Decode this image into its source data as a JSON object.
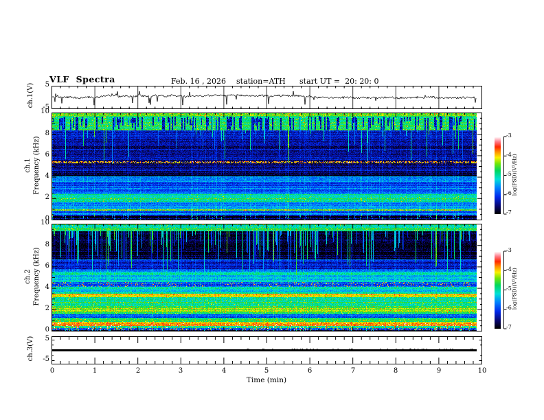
{
  "header": {
    "title": "VLF  Spectra",
    "date": "Feb. 16 , 2026",
    "station": "station=ATH",
    "start_ut": "start UT =  20: 20: 0"
  },
  "x_axis": {
    "label": "Time (min)",
    "min": 0,
    "max": 10,
    "tick_labels": [
      "0",
      "1",
      "2",
      "3",
      "4",
      "5",
      "6",
      "7",
      "8",
      "9",
      "10"
    ]
  },
  "panels": {
    "wave1": {
      "ylabel": "ch.1(V)",
      "ymax_label": "5",
      "ymin_label": "-5",
      "ylim": [
        -5,
        5
      ]
    },
    "spec1": {
      "channel_label": "ch.1",
      "ylabel": "Frequency (kHz)",
      "tick_labels": [
        "10",
        "8",
        "6",
        "4",
        "2",
        "0"
      ],
      "ylim": [
        0,
        10
      ]
    },
    "spec2": {
      "channel_label": "ch.2",
      "ylabel": "Frequency (kHz)",
      "tick_labels": [
        "10",
        "8",
        "6",
        "4",
        "2",
        "0"
      ],
      "ylim": [
        0,
        10
      ]
    },
    "wave3": {
      "ylabel": "ch.3(V)",
      "ymax_label": "5",
      "ymin_label": "-5",
      "ylim": [
        -5,
        5
      ]
    }
  },
  "colorbar": {
    "label": "log(PSD)(V²/Hz)",
    "tick_labels": [
      "-3",
      "-4",
      "-5",
      "-6",
      "-7"
    ],
    "zlim": [
      -7,
      -3
    ]
  },
  "colormap": {
    "stops": [
      [
        0.0,
        0,
        0,
        0
      ],
      [
        0.1,
        8,
        6,
        110
      ],
      [
        0.22,
        0,
        40,
        235
      ],
      [
        0.34,
        0,
        130,
        255
      ],
      [
        0.45,
        0,
        225,
        215
      ],
      [
        0.56,
        0,
        215,
        95
      ],
      [
        0.65,
        110,
        230,
        10
      ],
      [
        0.73,
        250,
        240,
        0
      ],
      [
        0.8,
        255,
        150,
        0
      ],
      [
        0.87,
        255,
        40,
        0
      ],
      [
        0.935,
        255,
        120,
        135
      ],
      [
        1.0,
        255,
        255,
        255
      ]
    ]
  },
  "chart_data": [
    {
      "type": "line",
      "name": "ch.1 voltage waveform",
      "ylabel": "ch.1(V)",
      "ylim": [
        -5,
        5
      ],
      "xlabel": "Time (min)",
      "xlim": [
        0,
        10
      ],
      "data_end_min": 9.88,
      "description": "Band-limited noise centered near +0.3 V (about ±0.8 V) with frequent impulsive downward spikes to -2…-4.5 V and sparser upward spikes to +1…+3 V",
      "mean_v": 0.3,
      "noise_v": 0.8,
      "seed": 42
    },
    {
      "type": "heatmap",
      "name": "ch.1 spectrogram",
      "channel": "ch.1",
      "xlabel": "Time (min)",
      "xlim": [
        0,
        10
      ],
      "ylabel": "Frequency (kHz)",
      "ylim": [
        0,
        10
      ],
      "zlabel": "log(PSD)(V²/Hz)",
      "zlim": [
        -7,
        -3
      ],
      "data_end_min": 9.88,
      "bands": [
        [
          9.8,
          10.01,
          -4.45
        ],
        [
          8.4,
          9.8,
          -4.75
        ],
        [
          7.0,
          8.4,
          -6.35
        ],
        [
          5.5,
          7.0,
          -6.45
        ],
        [
          5.3,
          5.5,
          -3.9
        ],
        [
          4.6,
          5.3,
          -6.5
        ],
        [
          4.05,
          4.6,
          -6.75
        ],
        [
          3.55,
          4.05,
          -5.65
        ],
        [
          3.05,
          3.55,
          -6.0
        ],
        [
          2.45,
          3.05,
          -5.8
        ],
        [
          2.15,
          2.45,
          -5.15
        ],
        [
          1.65,
          2.15,
          -4.95
        ],
        [
          0.95,
          1.65,
          -5.6
        ],
        [
          0.78,
          0.95,
          -4.55
        ],
        [
          0.6,
          0.78,
          -5.9
        ],
        [
          0.42,
          0.6,
          -5.35
        ],
        [
          0.3,
          0.42,
          -6.5
        ],
        [
          0.12,
          0.3,
          -6.9
        ],
        [
          0,
          0.12,
          -6.6
        ]
      ],
      "sferics": {
        "prob": 0.3,
        "top": 9.8,
        "max_depth": 4.2
      },
      "canopy": {
        "top": 9.8,
        "base": 8.4,
        "wedge_prob": 0.45
      },
      "speckle": [
        {
          "lo": 5.3,
          "hi": 5.5,
          "p": 0.5,
          "alt": -6.6
        }
      ],
      "seed": 7
    },
    {
      "type": "heatmap",
      "name": "ch.2 spectrogram",
      "channel": "ch.2",
      "xlabel": "Time (min)",
      "xlim": [
        0,
        10
      ],
      "ylabel": "Frequency (kHz)",
      "ylim": [
        0,
        10
      ],
      "zlabel": "log(PSD)(V²/Hz)",
      "zlim": [
        -7,
        -3
      ],
      "data_end_min": 9.88,
      "bands": [
        [
          9.4,
          10.01,
          -4.95
        ],
        [
          6.72,
          9.4,
          -6.85
        ],
        [
          6.55,
          6.72,
          -6.0
        ],
        [
          5.8,
          6.55,
          -6.35
        ],
        [
          5.55,
          5.8,
          -5.9
        ],
        [
          5.2,
          5.55,
          -5.25
        ],
        [
          4.6,
          5.2,
          -5.35
        ],
        [
          4.1,
          4.6,
          -5.95
        ],
        [
          3.5,
          4.1,
          -5.25
        ],
        [
          3.15,
          3.5,
          -3.95
        ],
        [
          2.2,
          3.15,
          -4.9
        ],
        [
          1.75,
          2.2,
          -4.4
        ],
        [
          1.5,
          1.75,
          -5.0
        ],
        [
          1.2,
          1.5,
          -5.85
        ],
        [
          0.8,
          1.2,
          -4.85
        ],
        [
          0.45,
          0.8,
          -4.0
        ],
        [
          0.2,
          0.45,
          -4.95
        ],
        [
          0.05,
          0.2,
          -6.1
        ],
        [
          0,
          0.05,
          -7.0
        ]
      ],
      "sferics": {
        "prob": 0.38,
        "top": 9.45,
        "max_depth": 3.9
      },
      "speckle": [
        {
          "lo": 4.1,
          "hi": 4.6,
          "p": 0.1,
          "alt": -4.0
        },
        {
          "lo": 0.05,
          "hi": 0.2,
          "p": 0.12,
          "alt": -3.9
        }
      ],
      "seed": 13
    },
    {
      "type": "line",
      "name": "ch.3 voltage waveform",
      "ylabel": "ch.3(V)",
      "ylim": [
        -5,
        5
      ],
      "xlabel": "Time (min)",
      "xlim": [
        0,
        10
      ],
      "data_end_min": 9.88,
      "description": "Flat thick trace constant at 0 V for the whole interval",
      "value_v": 0,
      "seed": 5
    }
  ]
}
